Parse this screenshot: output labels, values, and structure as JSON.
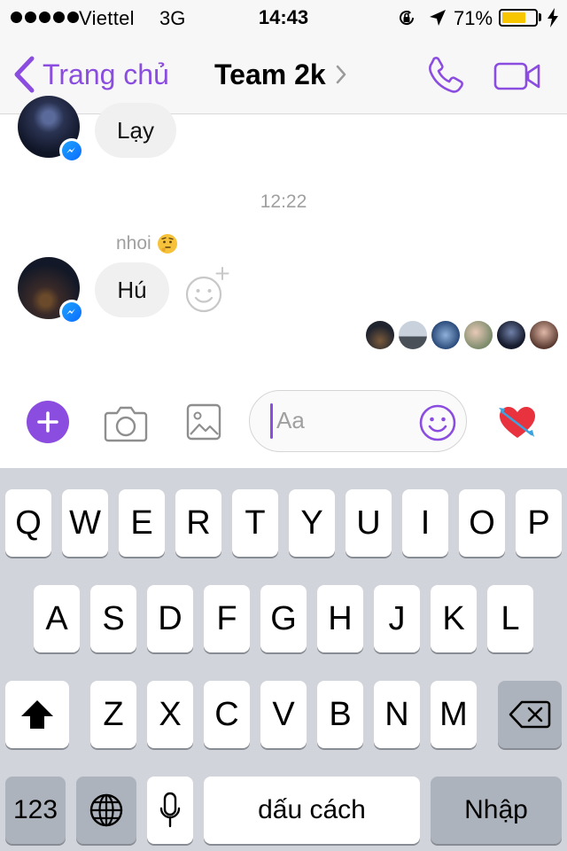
{
  "status_bar": {
    "carrier": "Viettel",
    "network": "3G",
    "time": "14:43",
    "battery_percent": "71%",
    "battery_level": 0.71,
    "icons": [
      "signal-dots-icon",
      "orientation-lock-icon",
      "location-arrow-icon",
      "battery-icon",
      "charging-bolt-icon"
    ]
  },
  "nav": {
    "back_label": "Trang chủ",
    "title": "Team 2k",
    "icons": [
      "chevron-left-icon",
      "chevron-right-icon",
      "phone-icon",
      "video-camera-icon"
    ]
  },
  "conversation": {
    "messages": [
      {
        "text": "Lạy"
      },
      {
        "sender": "nhoi",
        "text": "Hú"
      }
    ],
    "timestamp": "12:22",
    "seen_avatar_count": 6
  },
  "composer": {
    "placeholder": "Aa",
    "icons": [
      "plus-icon",
      "camera-icon",
      "image-icon",
      "smiley-icon",
      "heart-arrow-icon"
    ]
  },
  "keyboard": {
    "row1": [
      "Q",
      "W",
      "E",
      "R",
      "T",
      "Y",
      "U",
      "I",
      "O",
      "P"
    ],
    "row2": [
      "A",
      "S",
      "D",
      "F",
      "G",
      "H",
      "J",
      "K",
      "L"
    ],
    "row3": [
      "Z",
      "X",
      "C",
      "V",
      "B",
      "N",
      "M"
    ],
    "numbers_label": "123",
    "space_label": "dấu cách",
    "return_label": "Nhập"
  },
  "colors": {
    "accent": "#8b4de0",
    "bubble": "#f1f0f0",
    "keyboard_bg": "#d1d4db",
    "battery": "#f7c600"
  }
}
